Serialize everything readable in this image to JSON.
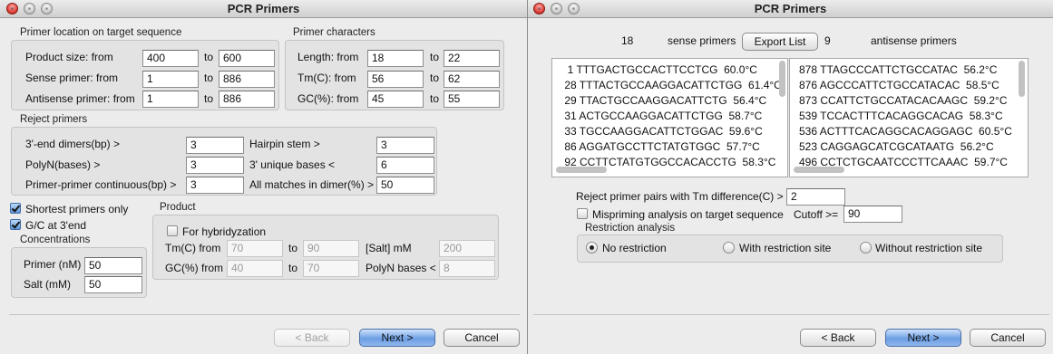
{
  "left_window": {
    "title": "PCR Primers",
    "location": {
      "group_label": "Primer location on target sequence",
      "product_size_label": "Product size: from",
      "product_size_from": "400",
      "product_size_to": "600",
      "sense_label": "Sense primer: from",
      "sense_from": "1",
      "sense_to": "886",
      "antisense_label": "Antisense primer: from",
      "antisense_from": "1",
      "antisense_to": "886",
      "to_label": "to"
    },
    "characters": {
      "group_label": "Primer characters",
      "length_label": "Length: from",
      "length_from": "18",
      "length_to": "22",
      "tm_label": "Tm(C): from",
      "tm_from": "56",
      "tm_to": "62",
      "gc_label": "GC(%): from",
      "gc_from": "45",
      "gc_to": "55",
      "to_label": "to"
    },
    "reject": {
      "group_label": "Reject primers",
      "end_dimers_label": "3'-end dimers(bp) >",
      "end_dimers_value": "3",
      "polyn_label": "PolyN(bases) >",
      "polyn_value": "3",
      "continuous_label": "Primer-primer continuous(bp) >",
      "continuous_value": "3",
      "hairpin_label": "Hairpin stem >",
      "hairpin_value": "3",
      "unique_label": "3' unique bases <",
      "unique_value": "6",
      "matches_label": "All matches in dimer(%) >",
      "matches_value": "50"
    },
    "options": {
      "shortest_label": "Shortest primers only",
      "gc_end_label": "G/C at 3'end"
    },
    "concentrations": {
      "group_label": "Concentrations",
      "primer_label": "Primer (nM)",
      "primer_value": "50",
      "salt_label": "Salt (mM)",
      "salt_value": "50"
    },
    "product": {
      "group_label": "Product",
      "hybrid_label": "For hybridyzation",
      "tm_label": "Tm(C) from",
      "tm_from": "70",
      "tm_to": "90",
      "gc_label": "GC(%) from",
      "gc_from": "40",
      "gc_to": "70",
      "to_label": "to",
      "salt_label": "[Salt] mM",
      "salt_value": "200",
      "polyn_label": "PolyN bases <",
      "polyn_value": "8"
    },
    "buttons": {
      "back": "< Back",
      "next": "Next >",
      "cancel": "Cancel"
    }
  },
  "right_window": {
    "title": "PCR Primers",
    "sense_count": "18",
    "sense_label": "sense primers",
    "export_label": "Export List",
    "antisense_count": "9",
    "antisense_label": "antisense primers",
    "sense_list": [
      "  1 TTTGACTGCCACTTCCTCG  60.0°C",
      " 28 TTTACTGCCAAGGACATTCTGG  61.4°C",
      " 29 TTACTGCCAAGGACATTCTG  56.4°C",
      " 31 ACTGCCAAGGACATTCTGG  58.7°C",
      " 33 TGCCAAGGACATTCTGGAC  59.6°C",
      " 86 AGGATGCCTTCTATGTGGC  57.7°C",
      " 92 CCTTCTATGTGGCCACACCTG  58.3°C"
    ],
    "antisense_list": [
      "878 TTAGCCCATTCTGCCATAC  56.2°C",
      "876 AGCCCATTCTGCCATACAC  58.5°C",
      "873 CCATTCTGCCATACACAAGC  59.2°C",
      "539 TCCACTTTCACAGGCACAG  58.3°C",
      "536 ACTTTCACAGGCACAGGAGC  60.5°C",
      "523 CAGGAGCATCGCATAATG  56.2°C",
      "496 CCTCTGCAATCCCTTCAAAC  59.7°C"
    ],
    "reject_tm_label": "Reject primer pairs with Tm difference(C) >",
    "reject_tm_value": "2",
    "mispriming_label": "Mispriming analysis on target sequence",
    "cutoff_label": "Cutoff >=",
    "cutoff_value": "90",
    "restriction_label": "Restriction analysis",
    "no_restriction": "No restriction",
    "with_restriction": "With restriction site",
    "without_restriction": "Without restriction site",
    "buttons": {
      "back": "< Back",
      "next": "Next >",
      "cancel": "Cancel"
    }
  }
}
